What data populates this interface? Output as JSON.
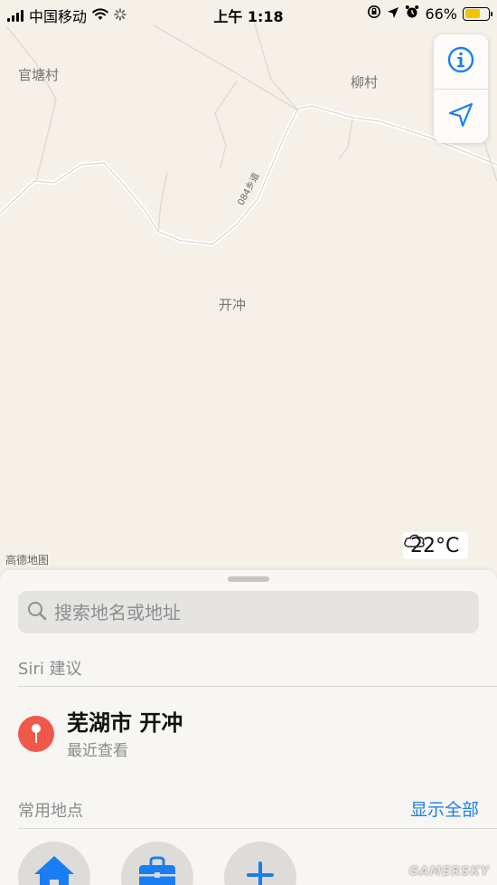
{
  "status_bar": {
    "carrier": "中国移动",
    "time": "上午 1:18",
    "battery_text": "66%",
    "battery_level": 0.66
  },
  "map": {
    "places": [
      "官塘村",
      "柳村",
      "开冲"
    ],
    "road_label": "084乡道",
    "provider": "高德地图",
    "weather": {
      "icon": "cloud-icon",
      "temperature": "22°C"
    },
    "buttons": [
      "info-icon",
      "location-arrow-icon"
    ]
  },
  "sheet": {
    "search_placeholder": "搜索地名或地址",
    "siri_section_title": "Siri 建议",
    "suggestion": {
      "title": "芜湖市 开冲",
      "subtitle": "最近查看",
      "icon": "map-pin-icon"
    },
    "favorites_section_title": "常用地点",
    "show_all_label": "显示全部",
    "favorites": [
      "home-icon",
      "work-briefcase-icon",
      "add-icon"
    ]
  },
  "watermark": "GAMERSKY",
  "colors": {
    "map_background": "#f5f0e8",
    "accent": "#1a7ef2",
    "pin": "#f0584a",
    "battery": "#f5c400"
  }
}
